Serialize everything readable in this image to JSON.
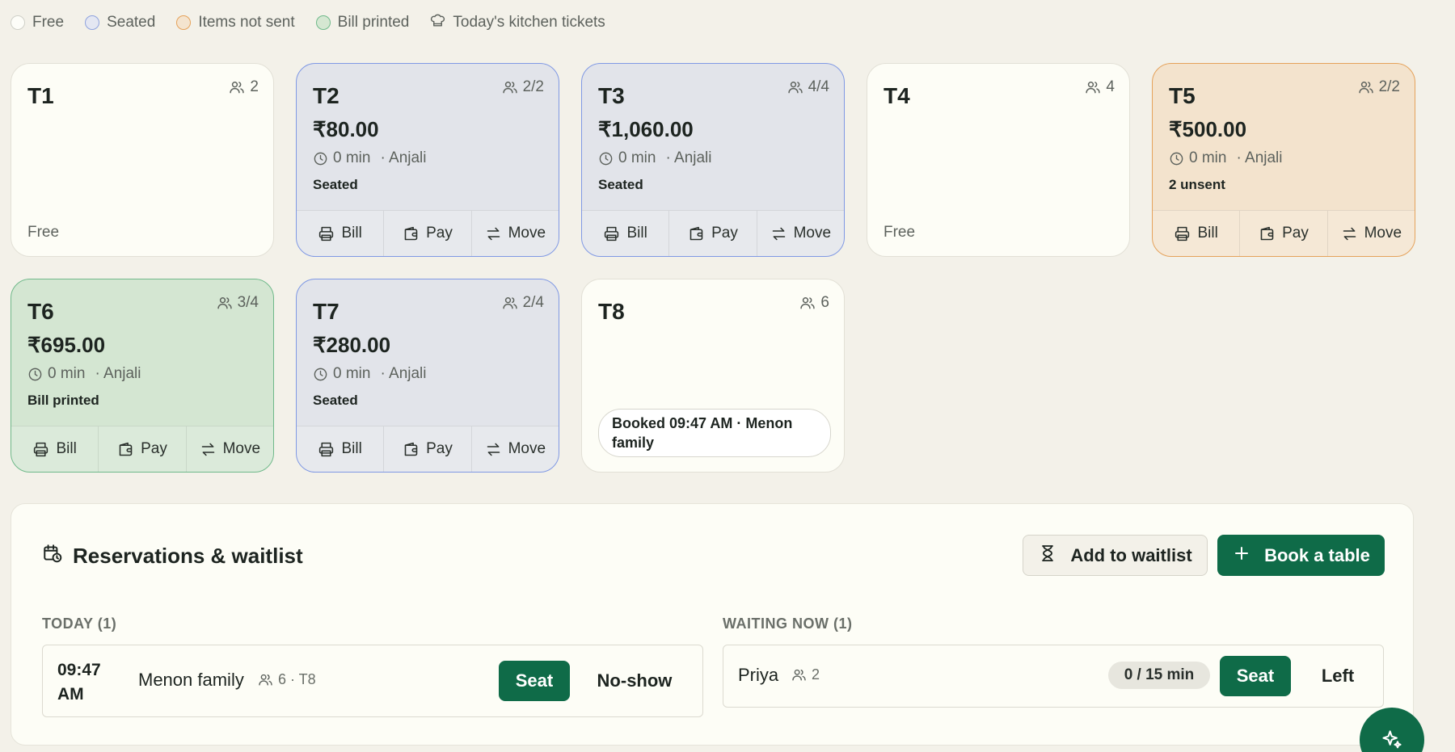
{
  "legend": {
    "free": "Free",
    "seated": "Seated",
    "items_not_sent": "Items not sent",
    "bill_printed": "Bill printed",
    "kitchen_tickets": "Today's kitchen tickets"
  },
  "actions": {
    "bill": "Bill",
    "pay": "Pay",
    "move": "Move"
  },
  "tables": [
    {
      "name": "T1",
      "guests": "2",
      "state": "free",
      "status": "Free"
    },
    {
      "name": "T2",
      "guests": "2/2",
      "state": "seated",
      "amount": "₹80.00",
      "time": "0 min",
      "server": "· Anjali",
      "status": "Seated"
    },
    {
      "name": "T3",
      "guests": "4/4",
      "state": "seated",
      "amount": "₹1,060.00",
      "time": "0 min",
      "server": "· Anjali",
      "status": "Seated"
    },
    {
      "name": "T4",
      "guests": "4",
      "state": "free",
      "status": "Free"
    },
    {
      "name": "T5",
      "guests": "2/2",
      "state": "unsent",
      "amount": "₹500.00",
      "time": "0 min",
      "server": "· Anjali",
      "status": "2 unsent"
    },
    {
      "name": "T6",
      "guests": "3/4",
      "state": "printed",
      "amount": "₹695.00",
      "time": "0 min",
      "server": "· Anjali",
      "status": "Bill printed"
    },
    {
      "name": "T7",
      "guests": "2/4",
      "state": "seated",
      "amount": "₹280.00",
      "time": "0 min",
      "server": "· Anjali",
      "status": "Seated"
    },
    {
      "name": "T8",
      "guests": "6",
      "state": "booked",
      "booking": "Booked 09:47 AM · Menon family"
    }
  ],
  "reservations": {
    "title": "Reservations & waitlist",
    "add_waitlist": "Add to waitlist",
    "book_table": "Book a table",
    "today_label": "TODAY (1)",
    "waiting_label": "WAITING NOW (1)",
    "today": [
      {
        "time": "09:47 AM",
        "name": "Menon family",
        "meta": "6 · T8",
        "seat": "Seat",
        "no_show": "No-show"
      }
    ],
    "waiting": [
      {
        "name": "Priya",
        "guests": "2",
        "timer": "0 / 15 min",
        "seat": "Seat",
        "left": "Left"
      }
    ]
  },
  "colors": {
    "brand_green": "#0f6b48",
    "seated": "#7f98e4",
    "unsent": "#e5a25a",
    "printed": "#6fb98a"
  }
}
